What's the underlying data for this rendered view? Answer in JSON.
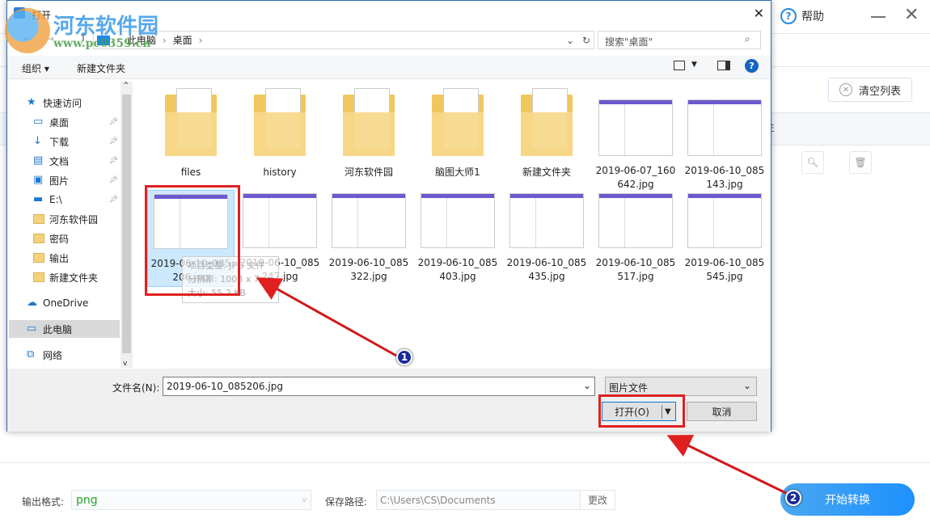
{
  "app": {
    "help_label": "帮助",
    "minimize_icon": "minimize-icon",
    "close_icon": "close-icon",
    "clear_list_label": "清空列表",
    "output_format_label": "输出格式:",
    "output_format_value": "png",
    "save_path_label": "保存路径:",
    "save_path_value": "C:\\Users\\CS\\Documents",
    "change_label": "更改",
    "start_label": "开始转换",
    "partial_header_char": "E"
  },
  "dialog": {
    "title": "打开",
    "breadcrumb": [
      "此电脑",
      "桌面"
    ],
    "search_placeholder": "搜索\"桌面\"",
    "toolbar": {
      "organize": "组织",
      "new_folder": "新建文件夹"
    },
    "nav": [
      {
        "label": "快速访问",
        "icon": "star-icon"
      },
      {
        "label": "桌面",
        "icon": "desktop-icon",
        "pinned": true
      },
      {
        "label": "下载",
        "icon": "download-icon",
        "pinned": true
      },
      {
        "label": "文档",
        "icon": "document-icon",
        "pinned": true
      },
      {
        "label": "图片",
        "icon": "picture-icon",
        "pinned": true
      },
      {
        "label": "E:\\",
        "icon": "drive-icon",
        "pinned": true
      },
      {
        "label": "河东软件园",
        "icon": "folder-icon"
      },
      {
        "label": "密码",
        "icon": "folder-icon"
      },
      {
        "label": "输出",
        "icon": "folder-icon"
      },
      {
        "label": "新建文件夹",
        "icon": "folder-icon"
      },
      {
        "label": "OneDrive",
        "icon": "cloud-icon"
      },
      {
        "label": "此电脑",
        "icon": "computer-icon",
        "selected": true
      },
      {
        "label": "网络",
        "icon": "network-icon"
      }
    ],
    "items_row1": [
      {
        "l1": "files",
        "l2": "",
        "type": "folder"
      },
      {
        "l1": "history",
        "l2": "",
        "type": "folder"
      },
      {
        "l1": "河东软件园",
        "l2": "",
        "type": "folder"
      },
      {
        "l1": "脑图大师1",
        "l2": "",
        "type": "folder"
      },
      {
        "l1": "新建文件夹",
        "l2": "",
        "type": "folder"
      },
      {
        "l1": "2019-06-07_160",
        "l2": "642.jpg",
        "type": "image"
      },
      {
        "l1": "2019-06-10_085",
        "l2": "143.jpg",
        "type": "image"
      }
    ],
    "items_row2": [
      {
        "l1": "2019-06-10_085",
        "l2": "206.jpg",
        "selected": true
      },
      {
        "l1": "2019-06-10_085",
        "l2": "247.jpg"
      },
      {
        "l1": "2019-06-10_085",
        "l2": "322.jpg"
      },
      {
        "l1": "2019-06-10_085",
        "l2": "403.jpg"
      },
      {
        "l1": "2019-06-10_085",
        "l2": "435.jpg"
      },
      {
        "l1": "2019-06-10_085",
        "l2": "517.jpg"
      },
      {
        "l1": "2019-06-10_085",
        "l2": "545.jpg"
      }
    ],
    "tooltip": [
      "项目类型: JPG 文件",
      "分辨率: 1008 x 7..",
      "大小: 55.2 KB"
    ],
    "filename_label": "文件名(N):",
    "filename_value": "2019-06-10_085206.jpg",
    "filetype_value": "图片文件",
    "open_label": "打开(O)",
    "cancel_label": "取消"
  },
  "annotations": {
    "badge1": "1",
    "badge2": "2",
    "color": "#e02020"
  },
  "watermark": {
    "name": "河东软件园",
    "url": "www.pc0359.cn"
  }
}
